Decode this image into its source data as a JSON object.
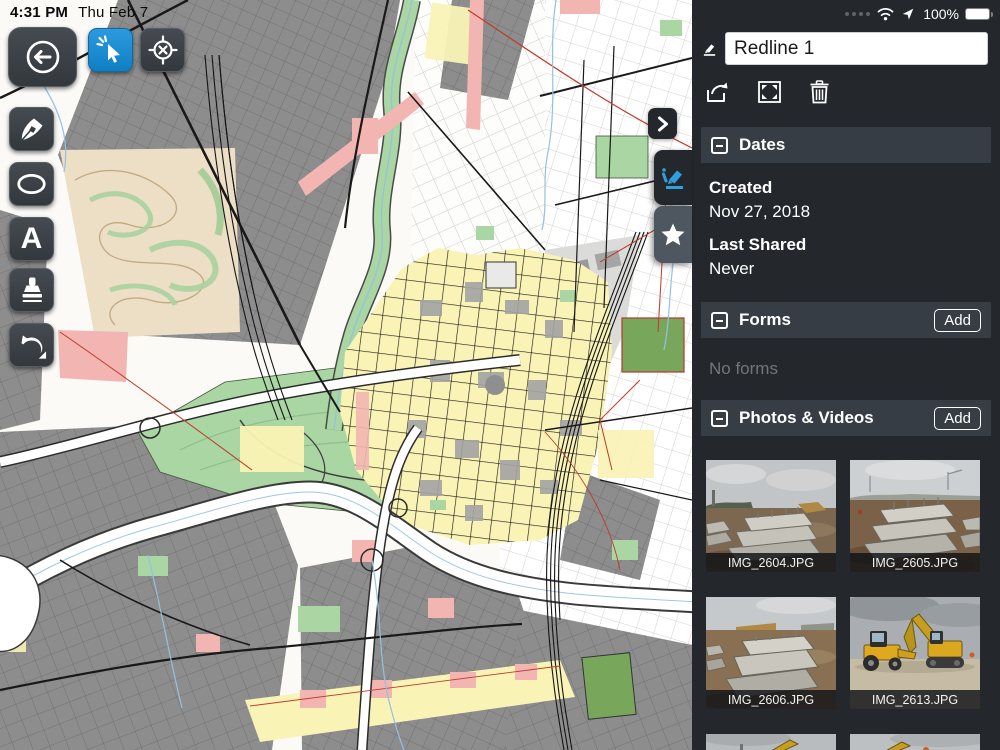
{
  "status_bar": {
    "time": "4:31 PM",
    "date": "Thu Feb 7",
    "battery_percent": "100%"
  },
  "toolbar": {
    "tools": [
      "back",
      "select",
      "locate",
      "draw",
      "ellipse",
      "text",
      "stamp",
      "undo"
    ],
    "active_tool": "select",
    "text_tool_glyph": "A"
  },
  "panel": {
    "title": {
      "value": "Redline 1"
    },
    "dates": {
      "title": "Dates",
      "created_label": "Created",
      "created_value": "Nov 27, 2018",
      "last_shared_label": "Last Shared",
      "last_shared_value": "Never"
    },
    "forms": {
      "title": "Forms",
      "add_label": "Add",
      "empty_text": "No forms"
    },
    "photos": {
      "title": "Photos & Videos",
      "add_label": "Add",
      "items": [
        {
          "name": "IMG_2604.JPG"
        },
        {
          "name": "IMG_2605.JPG"
        },
        {
          "name": "IMG_2606.JPG"
        },
        {
          "name": "IMG_2613.JPG"
        }
      ]
    }
  },
  "icons": {
    "header": "redline-marker-icon",
    "actions": [
      "share-export-icon",
      "fullscreen-icon",
      "trash-icon"
    ],
    "section_toggle": "collapse-minus-icon",
    "tabs": [
      "redline-marker-icon",
      "star-icon"
    ],
    "panel_collapse": "chevron-right-icon"
  },
  "colors": {
    "accent_blue": "#1e8fd5",
    "panel_bg": "#24282d",
    "section_header_bg": "#373d45",
    "map_gray": "#8d8d8d",
    "map_yellow": "#f9f3b5",
    "map_green": "#a9d6a2",
    "map_pink": "#f2b5b1",
    "map_red_line": "#c0392b",
    "map_water_blue": "#93c1e3"
  }
}
